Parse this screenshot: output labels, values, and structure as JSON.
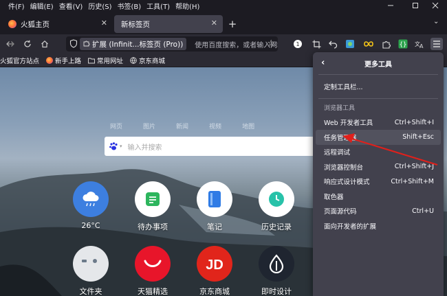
{
  "menubar": {
    "items": [
      "件(F)",
      "编辑(E)",
      "查看(V)",
      "历史(S)",
      "书签(B)",
      "工具(T)",
      "帮助(H)"
    ],
    "minimize_icon": "minimize-icon",
    "maximize_icon": "maximize-icon",
    "close_icon": "close-icon"
  },
  "tabs": [
    {
      "title": "火狐主页",
      "active": false
    },
    {
      "title": "新标签页",
      "active": true
    }
  ],
  "navbar": {
    "extension_chip": "扩展 (Infinit...标签页 (Pro))",
    "url_placeholder": "使用百度搜索，或者输入网址"
  },
  "bookmarks": [
    {
      "label": "火狐官方站点",
      "icon": "firefox-icon"
    },
    {
      "label": "新手上路",
      "icon": "firefox-icon"
    },
    {
      "label": "常用网址",
      "icon": "folder-icon"
    },
    {
      "label": "京东商城",
      "icon": "globe-icon"
    }
  ],
  "newtab_page": {
    "search_tabs": [
      "网页",
      "图片",
      "新闻",
      "视频",
      "地图"
    ],
    "search_placeholder": "输入并搜索",
    "tiles": [
      {
        "label": "26°C",
        "icon": "weather-cloud-icon",
        "color": "#3d7fe0"
      },
      {
        "label": "待办事项",
        "icon": "todo-icon",
        "color": "#ffffff"
      },
      {
        "label": "笔记",
        "icon": "notes-icon",
        "color": "#ffffff"
      },
      {
        "label": "历史记录",
        "icon": "history-clock-icon",
        "color": "#ffffff"
      },
      {
        "label": "文件夹",
        "icon": "folder-tile-icon",
        "color": "#e5e7ea"
      },
      {
        "label": "天猫精选",
        "icon": "tmall-icon",
        "color": "#e8152a"
      },
      {
        "label": "京东商城",
        "icon": "jd-icon",
        "color": "#e1251b"
      },
      {
        "label": "即时设计",
        "icon": "jishi-design-icon",
        "color": "#1f2530"
      }
    ]
  },
  "more_tools_panel": {
    "title": "更多工具",
    "customize_toolbar": "定制工具栏...",
    "browser_tools_heading": "浏览器工具",
    "items": [
      {
        "label": "Web 开发者工具",
        "shortcut": "Ctrl+Shift+I",
        "highlighted": false
      },
      {
        "label": "任务管理器",
        "shortcut": "Shift+Esc",
        "highlighted": true
      },
      {
        "label": "远程调试",
        "shortcut": "",
        "highlighted": false
      },
      {
        "label": "浏览器控制台",
        "shortcut": "Ctrl+Shift+J",
        "highlighted": false
      },
      {
        "label": "响应式设计模式",
        "shortcut": "Ctrl+Shift+M",
        "highlighted": false
      },
      {
        "label": "取色器",
        "shortcut": "",
        "highlighted": false
      },
      {
        "label": "页面源代码",
        "shortcut": "Ctrl+U",
        "highlighted": false
      },
      {
        "label": "面向开发者的扩展",
        "shortcut": "",
        "highlighted": false
      }
    ]
  },
  "colors": {
    "panel_bg": "#42414d",
    "annotation_arrow": "#e0201b"
  }
}
